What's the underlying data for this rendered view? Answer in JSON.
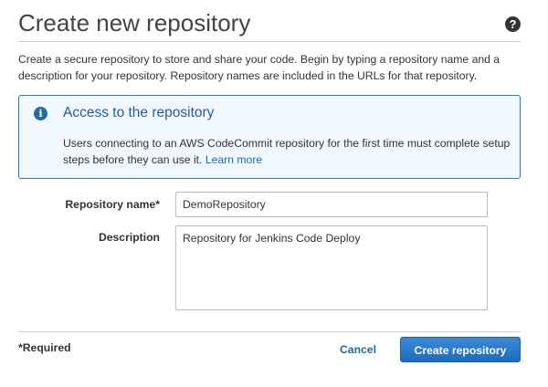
{
  "dialog": {
    "title": "Create new repository",
    "help_icon": "help-circle-icon",
    "help_glyph": "?",
    "intro": "Create a secure repository to store and share your code. Begin by typing a repository name and a description for your repository. Repository names are included in the URLs for that repository."
  },
  "info_box": {
    "icon": "info-circle-icon",
    "icon_glyph": "i",
    "title": "Access to the repository",
    "text": "Users connecting to an AWS CodeCommit repository for the first time must complete setup steps before they can use it.",
    "link_text": "Learn more"
  },
  "form": {
    "repo_name_label": "Repository name*",
    "repo_name_value": "DemoRepository",
    "description_label": "Description",
    "description_value": "Repository for Jenkins Code Deploy"
  },
  "footer": {
    "required_note": "*Required",
    "cancel_label": "Cancel",
    "create_label": "Create repository"
  },
  "colors": {
    "accent": "#1f6aa8",
    "info_background": "#f1f8fd",
    "primary_button": "#2a7acb"
  }
}
